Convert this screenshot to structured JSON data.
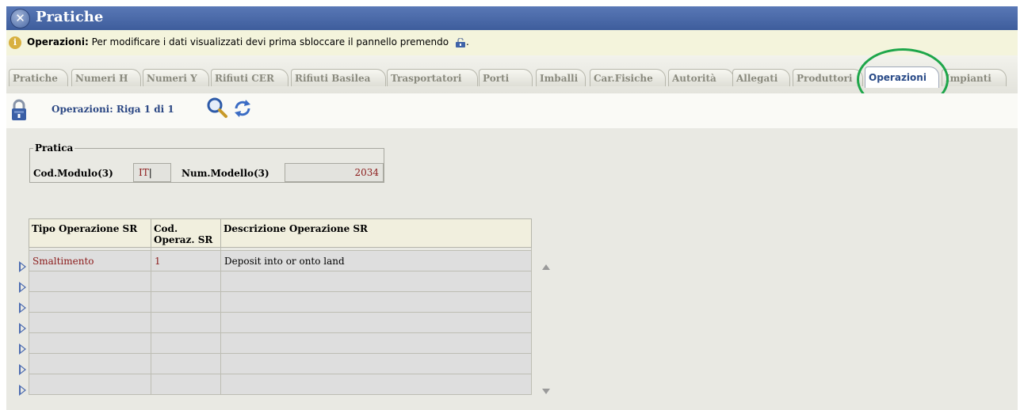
{
  "window": {
    "title": "Pratiche",
    "close_icon": "close-x-icon"
  },
  "info": {
    "icon": "info-icon",
    "label": "Operazioni:",
    "message": "Per modificare i dati visualizzati devi prima sbloccare il pannello premendo",
    "suffix": "."
  },
  "tabs": [
    {
      "label": "Pratiche"
    },
    {
      "label": "Numeri H"
    },
    {
      "label": "Numeri Y"
    },
    {
      "label": "Rifiuti CER"
    },
    {
      "label": "Rifiuti Basilea"
    },
    {
      "label": "Trasportatori"
    },
    {
      "label": "Porti"
    },
    {
      "label": "Imballi"
    },
    {
      "label": "Car.Fisiche"
    },
    {
      "label": "Autorità"
    },
    {
      "label": "Allegati"
    },
    {
      "label": "Produttori"
    },
    {
      "label": "Operazioni",
      "active": true
    },
    {
      "label": "Impianti"
    }
  ],
  "toolbar": {
    "record_label": "Operazioni: Riga 1 di 1",
    "lock_icon": "lock-icon",
    "search_icon": "search-icon",
    "refresh_icon": "refresh-icon"
  },
  "pratica": {
    "legend": "Pratica",
    "cod_modulo_label": "Cod.Modulo(3)",
    "cod_modulo_value": "IT",
    "num_modello_label": "Num.Modello(3)",
    "num_modello_value": "2034"
  },
  "table": {
    "headers": [
      "Tipo Operazione SR",
      "Cod. Operaz. SR",
      "Descrizione Operazione SR"
    ],
    "rows": [
      [
        "Smaltimento",
        "1",
        "Deposit into or onto land"
      ],
      [
        "",
        "",
        ""
      ],
      [
        "",
        "",
        ""
      ],
      [
        "",
        "",
        ""
      ],
      [
        "",
        "",
        ""
      ],
      [
        "",
        "",
        ""
      ],
      [
        "",
        "",
        ""
      ]
    ]
  },
  "colors": {
    "title_bar": "#4a69a8",
    "active_tab_text": "#2a4b88",
    "highlight_circle": "#1ea64a",
    "value_text": "#8b1a1a"
  }
}
